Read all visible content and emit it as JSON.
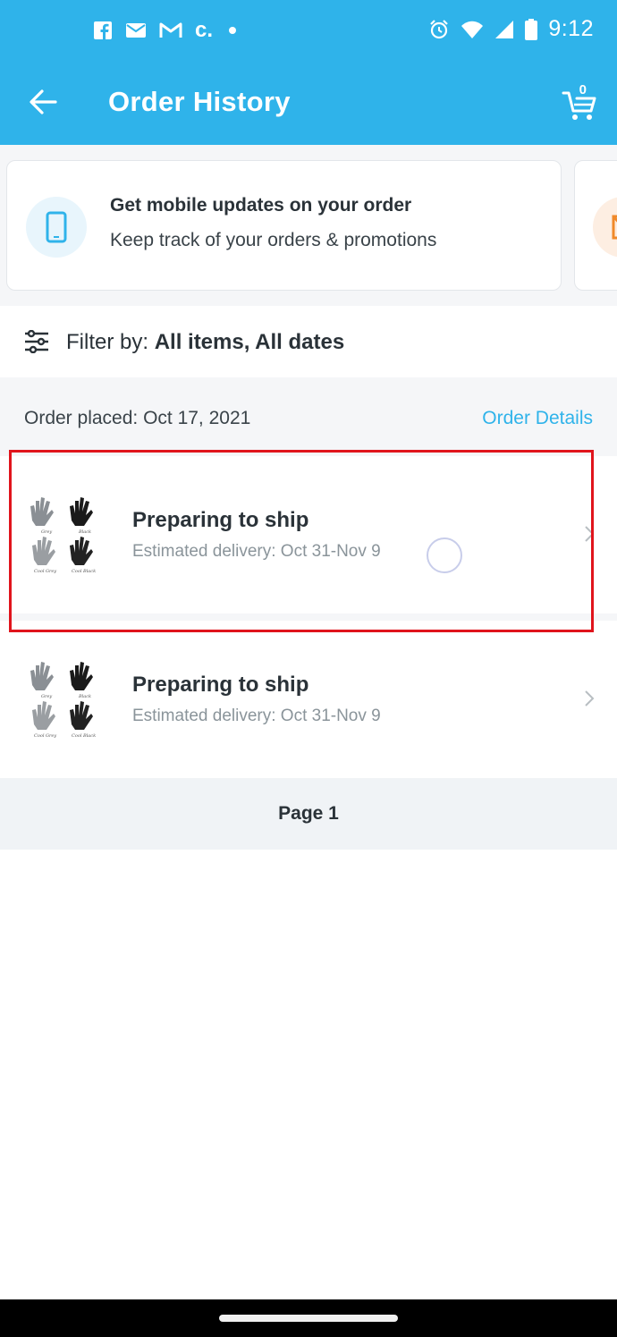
{
  "status_bar": {
    "time": "9:12",
    "carrier_letter": "c.",
    "icons": [
      "facebook-icon",
      "mail-icon",
      "gmail-icon",
      "alarm-icon",
      "wifi-icon",
      "signal-icon",
      "battery-icon"
    ]
  },
  "app_bar": {
    "title": "Order History",
    "cart_count": "0",
    "back_icon": "arrow-left-icon",
    "cart_icon": "cart-icon"
  },
  "promo": {
    "title": "Get mobile updates on your order",
    "subtitle": "Keep track of your orders & promotions",
    "icon": "phone-icon"
  },
  "filter": {
    "label": "Filter by: ",
    "value": "All items, All dates"
  },
  "order": {
    "placed_label": "Order placed: Oct 17, 2021",
    "details_link": "Order Details",
    "items": [
      {
        "status": "Preparing to ship",
        "delivery": "Estimated delivery: Oct 31-Nov 9",
        "thumb_labels": [
          "Grey",
          "Black",
          "Cool Grey",
          "Cool Black"
        ]
      },
      {
        "status": "Preparing to ship",
        "delivery": "Estimated delivery: Oct 31-Nov 9",
        "thumb_labels": [
          "Grey",
          "Black",
          "Cool Grey",
          "Cool Black"
        ]
      }
    ]
  },
  "pagination": {
    "label": "Page 1"
  },
  "colors": {
    "brand": "#2fb3ea",
    "highlight": "#e0141c",
    "background_alt": "#f5f6f8"
  }
}
